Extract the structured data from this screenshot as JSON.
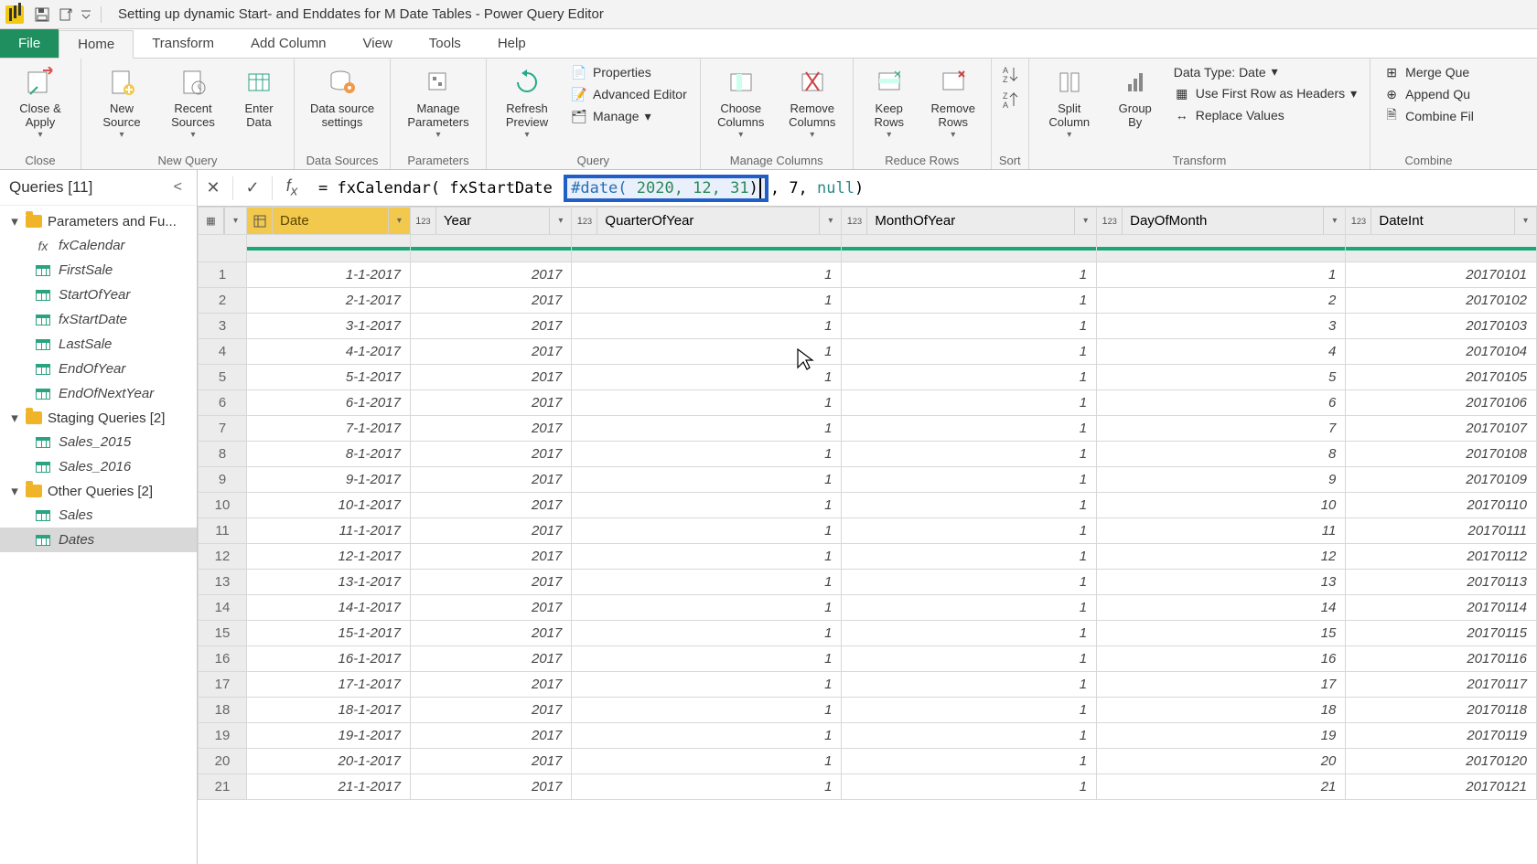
{
  "window": {
    "title": "Setting up dynamic Start- and Enddates for M Date Tables - Power Query Editor"
  },
  "tabs": {
    "file": "File",
    "home": "Home",
    "transform": "Transform",
    "add_column": "Add Column",
    "view": "View",
    "tools": "Tools",
    "help": "Help"
  },
  "ribbon": {
    "close_apply": "Close &\nApply",
    "close_group": "Close",
    "new_source": "New\nSource",
    "recent_sources": "Recent\nSources",
    "enter_data": "Enter\nData",
    "new_query_group": "New Query",
    "data_source_settings": "Data source\nsettings",
    "data_sources_group": "Data Sources",
    "manage_parameters": "Manage\nParameters",
    "parameters_group": "Parameters",
    "refresh_preview": "Refresh\nPreview",
    "properties": "Properties",
    "advanced_editor": "Advanced Editor",
    "manage": "Manage",
    "query_group": "Query",
    "choose_columns": "Choose\nColumns",
    "remove_columns": "Remove\nColumns",
    "manage_columns_group": "Manage Columns",
    "keep_rows": "Keep\nRows",
    "remove_rows": "Remove\nRows",
    "reduce_rows_group": "Reduce Rows",
    "sort_group": "Sort",
    "split_column": "Split\nColumn",
    "group_by": "Group\nBy",
    "data_type": "Data Type: Date",
    "first_row_headers": "Use First Row as Headers",
    "replace_values": "Replace Values",
    "transform_group": "Transform",
    "merge_queries": "Merge Que",
    "append_queries": "Append Qu",
    "combine_files": "Combine Fil",
    "combine_group": "Combine"
  },
  "queries": {
    "header": "Queries [11]",
    "group1": "Parameters and Fu...",
    "fxCalendar": "fxCalendar",
    "FirstSale": "FirstSale",
    "StartOfYear": "StartOfYear",
    "fxStartDate": "fxStartDate",
    "LastSale": "LastSale",
    "EndOfYear": "EndOfYear",
    "EndOfNextYear": "EndOfNextYear",
    "group2": "Staging Queries [2]",
    "Sales_2015": "Sales_2015",
    "Sales_2016": "Sales_2016",
    "group3": "Other Queries [2]",
    "Sales": "Sales",
    "Dates": "Dates"
  },
  "formula": {
    "prefix": "= fxCalendar( fxStartDate ",
    "highlight_kw": "#date(",
    "highlight_args": " 2020, 12, 31",
    "highlight_close": ")",
    "suffix_a": ", 7, ",
    "suffix_null": "null",
    "suffix_b": ")"
  },
  "columns": [
    "Date",
    "Year",
    "QuarterOfYear",
    "MonthOfYear",
    "DayOfMonth",
    "DateInt"
  ],
  "rows": [
    {
      "n": "1",
      "Date": "1-1-2017",
      "Year": "2017",
      "QuarterOfYear": "1",
      "MonthOfYear": "1",
      "DayOfMonth": "1",
      "DateInt": "20170101"
    },
    {
      "n": "2",
      "Date": "2-1-2017",
      "Year": "2017",
      "QuarterOfYear": "1",
      "MonthOfYear": "1",
      "DayOfMonth": "2",
      "DateInt": "20170102"
    },
    {
      "n": "3",
      "Date": "3-1-2017",
      "Year": "2017",
      "QuarterOfYear": "1",
      "MonthOfYear": "1",
      "DayOfMonth": "3",
      "DateInt": "20170103"
    },
    {
      "n": "4",
      "Date": "4-1-2017",
      "Year": "2017",
      "QuarterOfYear": "1",
      "MonthOfYear": "1",
      "DayOfMonth": "4",
      "DateInt": "20170104"
    },
    {
      "n": "5",
      "Date": "5-1-2017",
      "Year": "2017",
      "QuarterOfYear": "1",
      "MonthOfYear": "1",
      "DayOfMonth": "5",
      "DateInt": "20170105"
    },
    {
      "n": "6",
      "Date": "6-1-2017",
      "Year": "2017",
      "QuarterOfYear": "1",
      "MonthOfYear": "1",
      "DayOfMonth": "6",
      "DateInt": "20170106"
    },
    {
      "n": "7",
      "Date": "7-1-2017",
      "Year": "2017",
      "QuarterOfYear": "1",
      "MonthOfYear": "1",
      "DayOfMonth": "7",
      "DateInt": "20170107"
    },
    {
      "n": "8",
      "Date": "8-1-2017",
      "Year": "2017",
      "QuarterOfYear": "1",
      "MonthOfYear": "1",
      "DayOfMonth": "8",
      "DateInt": "20170108"
    },
    {
      "n": "9",
      "Date": "9-1-2017",
      "Year": "2017",
      "QuarterOfYear": "1",
      "MonthOfYear": "1",
      "DayOfMonth": "9",
      "DateInt": "20170109"
    },
    {
      "n": "10",
      "Date": "10-1-2017",
      "Year": "2017",
      "QuarterOfYear": "1",
      "MonthOfYear": "1",
      "DayOfMonth": "10",
      "DateInt": "20170110"
    },
    {
      "n": "11",
      "Date": "11-1-2017",
      "Year": "2017",
      "QuarterOfYear": "1",
      "MonthOfYear": "1",
      "DayOfMonth": "11",
      "DateInt": "20170111"
    },
    {
      "n": "12",
      "Date": "12-1-2017",
      "Year": "2017",
      "QuarterOfYear": "1",
      "MonthOfYear": "1",
      "DayOfMonth": "12",
      "DateInt": "20170112"
    },
    {
      "n": "13",
      "Date": "13-1-2017",
      "Year": "2017",
      "QuarterOfYear": "1",
      "MonthOfYear": "1",
      "DayOfMonth": "13",
      "DateInt": "20170113"
    },
    {
      "n": "14",
      "Date": "14-1-2017",
      "Year": "2017",
      "QuarterOfYear": "1",
      "MonthOfYear": "1",
      "DayOfMonth": "14",
      "DateInt": "20170114"
    },
    {
      "n": "15",
      "Date": "15-1-2017",
      "Year": "2017",
      "QuarterOfYear": "1",
      "MonthOfYear": "1",
      "DayOfMonth": "15",
      "DateInt": "20170115"
    },
    {
      "n": "16",
      "Date": "16-1-2017",
      "Year": "2017",
      "QuarterOfYear": "1",
      "MonthOfYear": "1",
      "DayOfMonth": "16",
      "DateInt": "20170116"
    },
    {
      "n": "17",
      "Date": "17-1-2017",
      "Year": "2017",
      "QuarterOfYear": "1",
      "MonthOfYear": "1",
      "DayOfMonth": "17",
      "DateInt": "20170117"
    },
    {
      "n": "18",
      "Date": "18-1-2017",
      "Year": "2017",
      "QuarterOfYear": "1",
      "MonthOfYear": "1",
      "DayOfMonth": "18",
      "DateInt": "20170118"
    },
    {
      "n": "19",
      "Date": "19-1-2017",
      "Year": "2017",
      "QuarterOfYear": "1",
      "MonthOfYear": "1",
      "DayOfMonth": "19",
      "DateInt": "20170119"
    },
    {
      "n": "20",
      "Date": "20-1-2017",
      "Year": "2017",
      "QuarterOfYear": "1",
      "MonthOfYear": "1",
      "DayOfMonth": "20",
      "DateInt": "20170120"
    },
    {
      "n": "21",
      "Date": "21-1-2017",
      "Year": "2017",
      "QuarterOfYear": "1",
      "MonthOfYear": "1",
      "DayOfMonth": "21",
      "DateInt": "20170121"
    }
  ]
}
